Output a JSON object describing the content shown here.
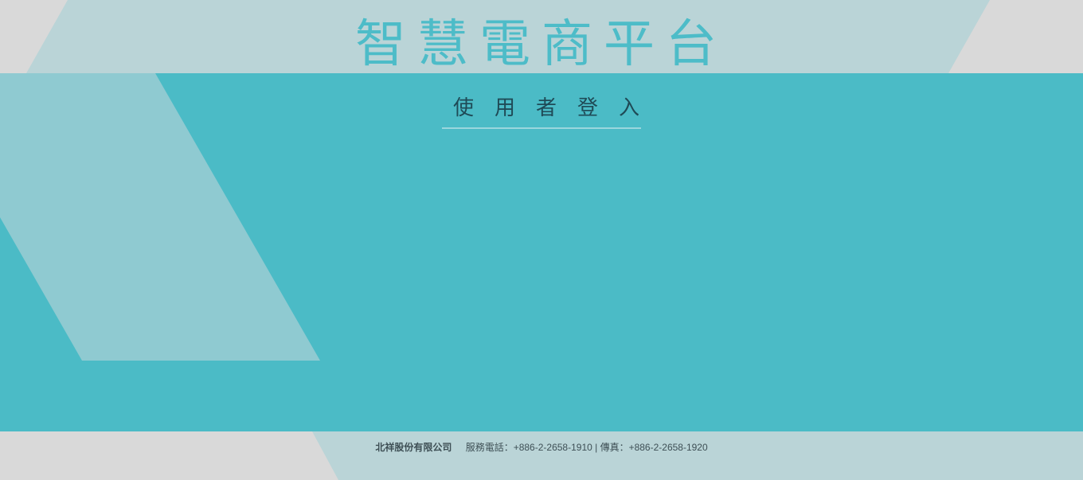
{
  "header": {
    "title": "智慧電商平台"
  },
  "login": {
    "heading": "使用者登入"
  },
  "footer": {
    "company": "北祥股份有限公司",
    "contact": "服務電話：+886-2-2658-1910 | 傳真：+886-2-2658-1920"
  },
  "colors": {
    "teal": "#4bbbc6",
    "light_teal_overlay": "#8fcad1",
    "pale_band": "#bad4d7",
    "gray": "#d9d9d9",
    "title": "#4dbcc8",
    "heading_text": "#1f4a56",
    "footer_text": "#3e4f55"
  }
}
